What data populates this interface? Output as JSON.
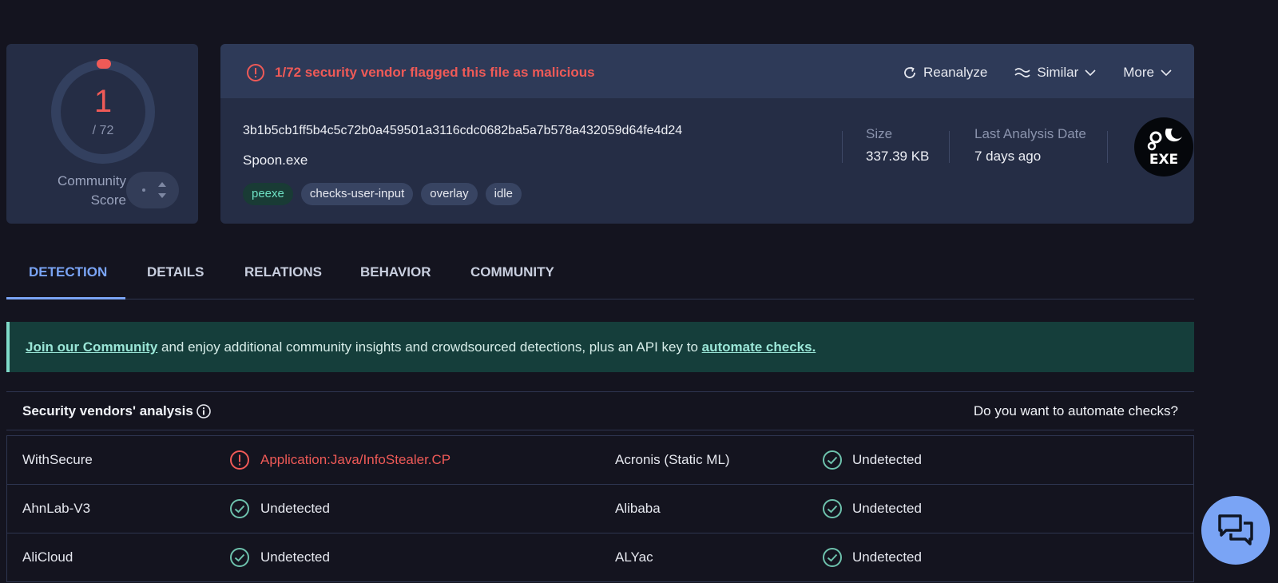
{
  "score": {
    "detections": "1",
    "total": "/ 72",
    "community_label": "Community\nScore"
  },
  "alert": {
    "text": "1/72 security vendor flagged this file as malicious"
  },
  "actions": {
    "reanalyze": "Reanalyze",
    "similar": "Similar",
    "more": "More"
  },
  "file": {
    "hash": "3b1b5cb1ff5b4c5c72b0a459501a3116cdc0682ba5a7b578a432059d64fe4d24",
    "name": "Spoon.exe",
    "tags": [
      "peexe",
      "checks-user-input",
      "overlay",
      "idle"
    ],
    "size_label": "Size",
    "size_value": "337.39 KB",
    "date_label": "Last Analysis Date",
    "date_value": "7 days ago",
    "type_icon_text": "EXE"
  },
  "tabs": [
    "DETECTION",
    "DETAILS",
    "RELATIONS",
    "BEHAVIOR",
    "COMMUNITY"
  ],
  "banner": {
    "join_link": "Join our Community",
    "middle_text": " and enjoy additional community insights and crowdsourced detections, plus an API key to ",
    "automate_link": "automate checks."
  },
  "vendors": {
    "title": "Security vendors' analysis",
    "automate_question": "Do you want to automate checks?",
    "rows": [
      [
        {
          "name": "WithSecure",
          "result": "Application:Java/InfoStealer.CP",
          "status": "malicious"
        },
        {
          "name": "Acronis (Static ML)",
          "result": "Undetected",
          "status": "undetected"
        }
      ],
      [
        {
          "name": "AhnLab-V3",
          "result": "Undetected",
          "status": "undetected"
        },
        {
          "name": "Alibaba",
          "result": "Undetected",
          "status": "undetected"
        }
      ],
      [
        {
          "name": "AliCloud",
          "result": "Undetected",
          "status": "undetected"
        },
        {
          "name": "ALYac",
          "result": "Undetected",
          "status": "undetected"
        }
      ]
    ]
  },
  "colors": {
    "malicious": "#ef5a57",
    "undetected": "#6ec2ad",
    "accent": "#7aa4f5"
  }
}
